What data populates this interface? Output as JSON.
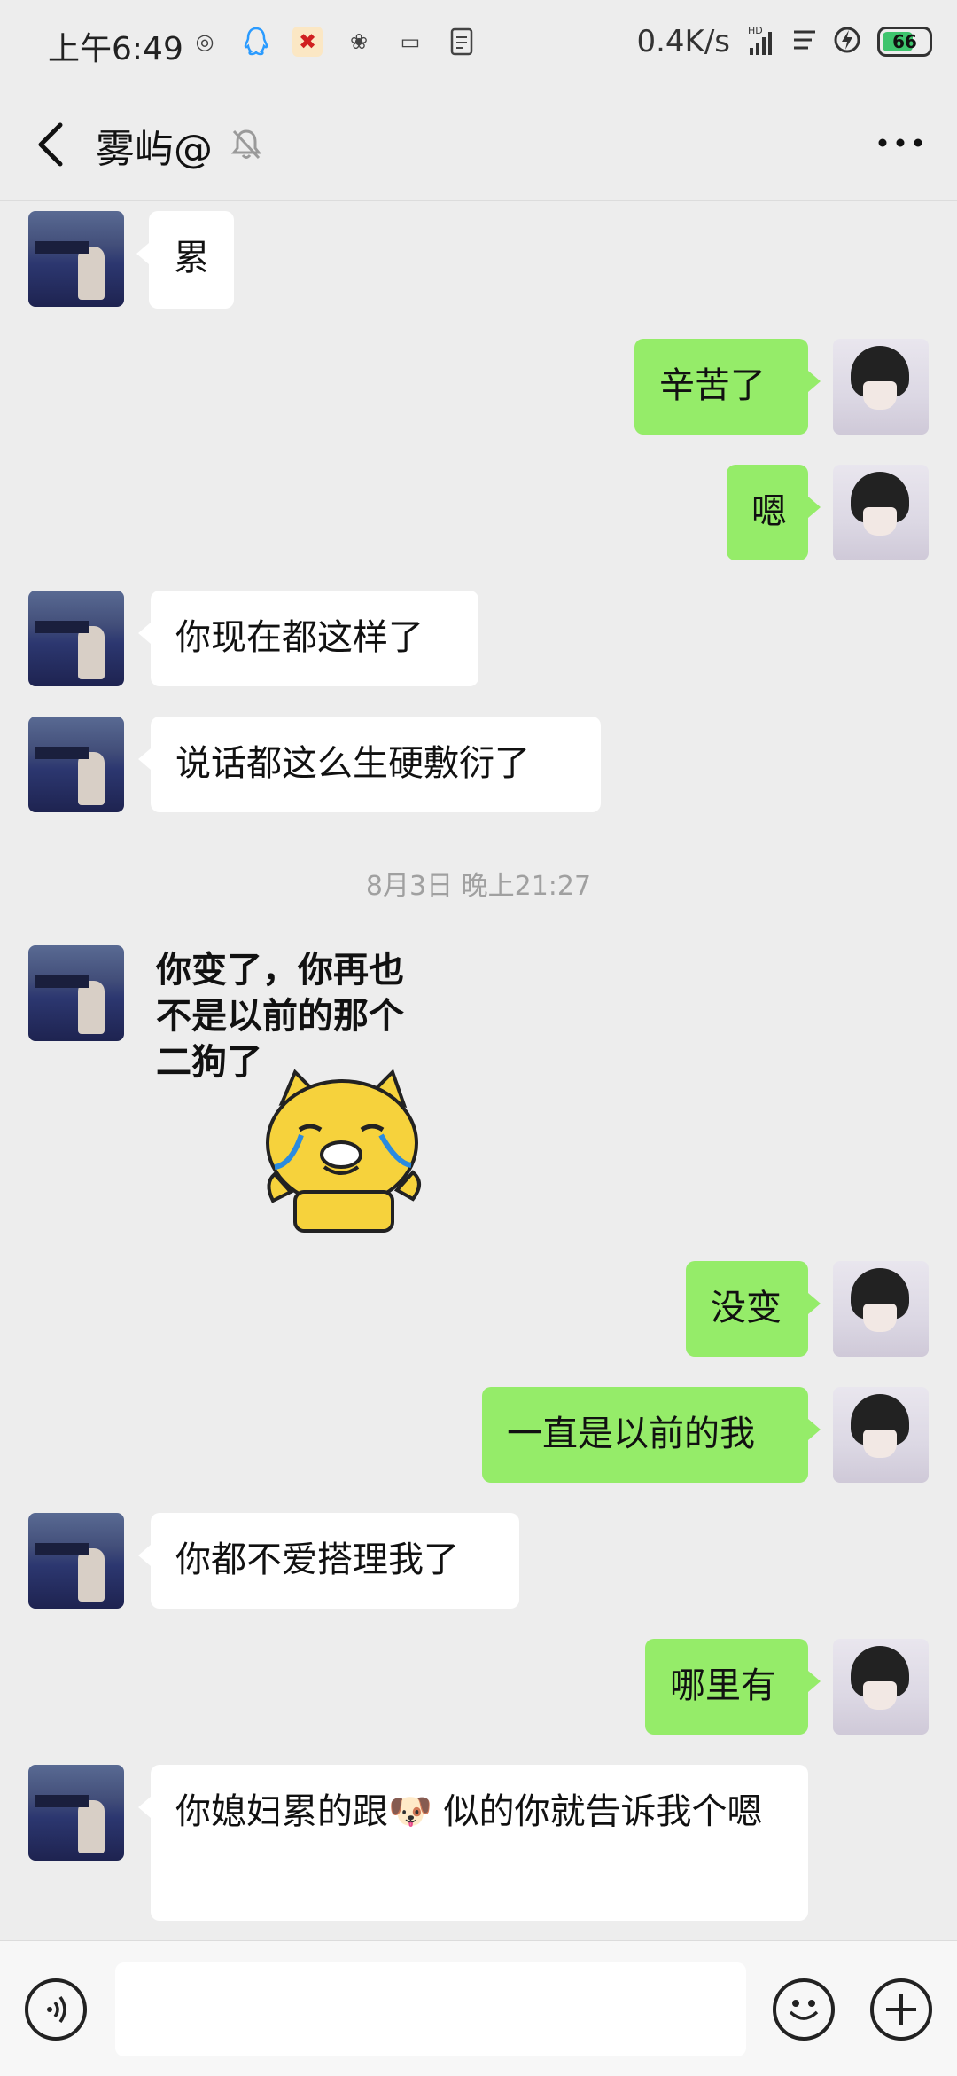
{
  "status_bar": {
    "time": "上午6:49",
    "net_speed": "0.4K/s",
    "signal": "HD",
    "battery": "66",
    "icons": [
      "target-icon",
      "qq-icon",
      "app-icon",
      "flower-icon",
      "message-icon",
      "document-icon"
    ]
  },
  "header": {
    "title": "雾屿@",
    "muted": true
  },
  "messages": [
    {
      "from": "her",
      "text": "累"
    },
    {
      "from": "me",
      "text": "辛苦了"
    },
    {
      "from": "me",
      "text": "嗯"
    },
    {
      "from": "her",
      "text": "你现在都这样了"
    },
    {
      "from": "her",
      "text": "说话都这么生硬敷衍了"
    },
    {
      "from": "her",
      "type": "sticker",
      "text": "你变了，你再也\n不是以前的那个\n二狗了"
    },
    {
      "from": "me",
      "text": "没变"
    },
    {
      "from": "me",
      "text": "一直是以前的我"
    },
    {
      "from": "her",
      "text": "你都不爱搭理我了"
    },
    {
      "from": "me",
      "text": "哪里有"
    },
    {
      "from": "her",
      "text": "你媳妇累的跟🐶 似的你就告诉我个嗯"
    }
  ],
  "timestamp": "8月3日 晚上21:27",
  "input": {
    "value": ""
  },
  "colors": {
    "accent_bubble": "#95ec69",
    "background": "#ededed"
  }
}
